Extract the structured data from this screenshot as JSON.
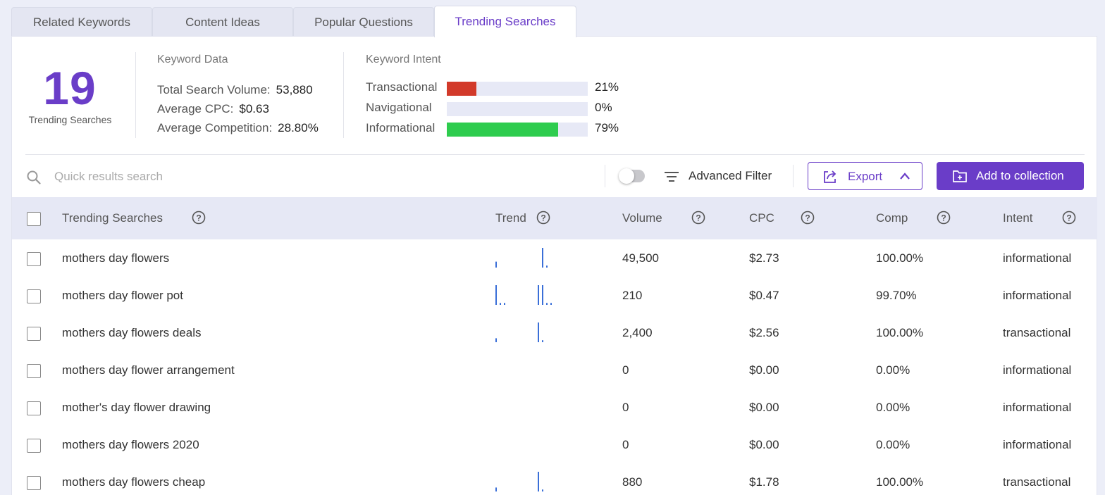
{
  "tabs": [
    {
      "label": "Related Keywords",
      "active": false
    },
    {
      "label": "Content Ideas",
      "active": false
    },
    {
      "label": "Popular Questions",
      "active": false
    },
    {
      "label": "Trending Searches",
      "active": true
    }
  ],
  "summary": {
    "count": "19",
    "label": "Trending Searches"
  },
  "keyword_data": {
    "title": "Keyword Data",
    "total_search_volume_label": "Total Search Volume:",
    "total_search_volume": "53,880",
    "average_cpc_label": "Average CPC:",
    "average_cpc": "$0.63",
    "average_competition_label": "Average Competition:",
    "average_competition": "28.80%"
  },
  "keyword_intent": {
    "title": "Keyword Intent",
    "items": [
      {
        "label": "Transactional",
        "percent": 21,
        "percent_text": "21%",
        "color": "#d23a2a"
      },
      {
        "label": "Navigational",
        "percent": 0,
        "percent_text": "0%",
        "color": "#888888"
      },
      {
        "label": "Informational",
        "percent": 79,
        "percent_text": "79%",
        "color": "#2ecc4e"
      }
    ]
  },
  "toolbar": {
    "search_placeholder": "Quick results search",
    "search_value": "",
    "toggle_on": false,
    "advanced_filter_label": "Advanced Filter",
    "export_label": "Export",
    "add_to_collection_label": "Add to collection"
  },
  "table": {
    "columns": {
      "keyword": "Trending Searches",
      "trend": "Trend",
      "volume": "Volume",
      "cpc": "CPC",
      "comp": "Comp",
      "intent": "Intent"
    },
    "rows": [
      {
        "keyword": "mothers day flowers",
        "volume": "49,500",
        "cpc": "$2.73",
        "comp": "100.00%",
        "intent": "informational",
        "trend": [
          0.3,
          0,
          0,
          0,
          0,
          0,
          0,
          0,
          0,
          0,
          0,
          1,
          0.1
        ]
      },
      {
        "keyword": "mothers day flower pot",
        "volume": "210",
        "cpc": "$0.47",
        "comp": "99.70%",
        "intent": "informational",
        "trend": [
          1,
          0.1,
          0.1,
          0,
          0,
          0,
          0,
          0,
          0,
          0,
          1,
          1,
          0.1,
          0.1
        ]
      },
      {
        "keyword": "mothers day flowers deals",
        "volume": "2,400",
        "cpc": "$2.56",
        "comp": "100.00%",
        "intent": "transactional",
        "trend": [
          0.2,
          0,
          0,
          0,
          0,
          0,
          0,
          0,
          0,
          0,
          1,
          0.1
        ]
      },
      {
        "keyword": "mothers day flower arrangement",
        "volume": "0",
        "cpc": "$0.00",
        "comp": "0.00%",
        "intent": "informational",
        "trend": []
      },
      {
        "keyword": "mother's day flower drawing",
        "volume": "0",
        "cpc": "$0.00",
        "comp": "0.00%",
        "intent": "informational",
        "trend": []
      },
      {
        "keyword": "mothers day flowers 2020",
        "volume": "0",
        "cpc": "$0.00",
        "comp": "0.00%",
        "intent": "informational",
        "trend": []
      },
      {
        "keyword": "mothers day flowers cheap",
        "volume": "880",
        "cpc": "$1.78",
        "comp": "100.00%",
        "intent": "transactional",
        "trend": [
          0.2,
          0,
          0,
          0,
          0,
          0,
          0,
          0,
          0,
          0,
          1,
          0.1
        ]
      }
    ]
  }
}
